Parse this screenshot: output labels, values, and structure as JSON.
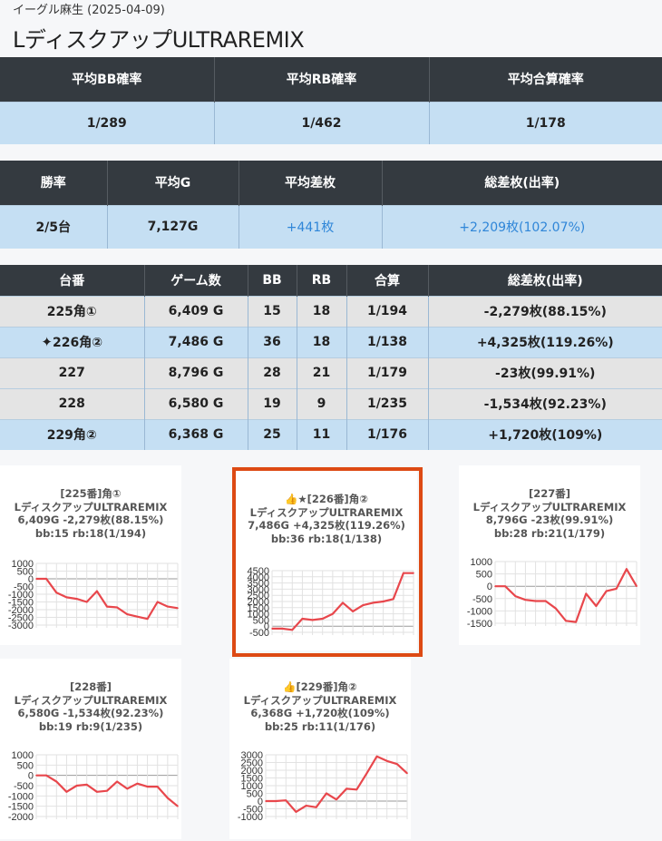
{
  "header": {
    "store_date": "イーグル麻生 (2025-04-09)",
    "machine_title": "LディスクアップULTRAREMIX"
  },
  "summary1": {
    "headers": [
      "平均BB確率",
      "平均RB確率",
      "平均合算確率"
    ],
    "values": [
      "1/289",
      "1/462",
      "1/178"
    ]
  },
  "summary2": {
    "headers": [
      "勝率",
      "平均G",
      "平均差枚",
      "総差枚(出率)"
    ],
    "values": [
      "2/5台",
      "7,127G",
      "+441枚",
      "+2,209枚(102.07%)"
    ]
  },
  "machines": {
    "headers": [
      "台番",
      "ゲーム数",
      "BB",
      "RB",
      "合算",
      "総差枚(出率)"
    ],
    "rows": [
      {
        "num": "225角①",
        "games": "6,409 G",
        "bb": "15",
        "rb": "18",
        "total": "1/194",
        "diff": "-2,279枚(88.15%)",
        "style": "gray",
        "icon": ""
      },
      {
        "num": "226角②",
        "games": "7,486 G",
        "bb": "36",
        "rb": "18",
        "total": "1/138",
        "diff": "+4,325枚(119.26%)",
        "style": "blue",
        "icon": "sparkles"
      },
      {
        "num": "227",
        "games": "8,796 G",
        "bb": "28",
        "rb": "21",
        "total": "1/179",
        "diff": "-23枚(99.91%)",
        "style": "gray",
        "icon": ""
      },
      {
        "num": "228",
        "games": "6,580 G",
        "bb": "19",
        "rb": "9",
        "total": "1/235",
        "diff": "-1,534枚(92.23%)",
        "style": "gray",
        "icon": ""
      },
      {
        "num": "229角②",
        "games": "6,368 G",
        "bb": "25",
        "rb": "11",
        "total": "1/176",
        "diff": "+1,720枚(109%)",
        "style": "blue",
        "icon": ""
      }
    ]
  },
  "chart_data": [
    {
      "type": "line",
      "title": [
        "[225番]角①",
        "LディスクアップULTRAREMIX",
        "6,409G -2,279枚(88.15%)",
        "bb:15 rb:18(1/194)"
      ],
      "ylim": [
        -3000,
        1000
      ],
      "yticks": [
        "1000",
        "500",
        "0",
        "-500",
        "-1000",
        "-1500",
        "-2000",
        "-2500",
        "-3000"
      ],
      "values": [
        0,
        0,
        -900,
        -1200,
        -1300,
        -1500,
        -800,
        -1800,
        -1850,
        -2300,
        -2450,
        -2600,
        -1500,
        -1800,
        -1900
      ],
      "color": "#e8474c"
    },
    {
      "type": "line",
      "title": [
        "👍★[226番]角②",
        "LディスクアップULTRAREMIX",
        "7,486G +4,325枚(119.26%)",
        "bb:36 rb:18(1/138)"
      ],
      "ylim": [
        -500,
        4500
      ],
      "yticks": [
        "4500",
        "4000",
        "3500",
        "3000",
        "2500",
        "2000",
        "1500",
        "1000",
        "500",
        "0",
        "-500"
      ],
      "values": [
        -200,
        -200,
        -300,
        600,
        500,
        600,
        1000,
        1900,
        1200,
        1700,
        1900,
        2000,
        2200,
        4300,
        4300
      ],
      "color": "#e8474c"
    },
    {
      "type": "line",
      "title": [
        "[227番]",
        "LディスクアップULTRAREMIX",
        "8,796G -23枚(99.91%)",
        "bb:28 rb:21(1/179)"
      ],
      "ylim": [
        -1500,
        1000
      ],
      "yticks": [
        "1000",
        "500",
        "0",
        "-500",
        "-1000",
        "-1500"
      ],
      "values": [
        0,
        0,
        -400,
        -550,
        -600,
        -600,
        -900,
        -1400,
        -1450,
        -300,
        -800,
        -200,
        -100,
        700,
        0
      ],
      "color": "#e8474c"
    },
    {
      "type": "line",
      "title": [
        "[228番]",
        "LディスクアップULTRAREMIX",
        "6,580G -1,534枚(92.23%)",
        "bb:19 rb:9(1/235)"
      ],
      "ylim": [
        -2000,
        1000
      ],
      "yticks": [
        "1000",
        "500",
        "0",
        "-500",
        "-1000",
        "-1500",
        "-2000"
      ],
      "values": [
        0,
        0,
        -300,
        -800,
        -500,
        -450,
        -800,
        -750,
        -300,
        -650,
        -400,
        -550,
        -550,
        -1100,
        -1500
      ],
      "color": "#e8474c"
    },
    {
      "type": "line",
      "title": [
        "👍[229番]角②",
        "LディスクアップULTRAREMIX",
        "6,368G +1,720枚(109%)",
        "bb:25 rb:11(1/176)"
      ],
      "ylim": [
        -1000,
        3000
      ],
      "yticks": [
        "3000",
        "2500",
        "2000",
        "1500",
        "1000",
        "500",
        "0",
        "-500",
        "-1000"
      ],
      "values": [
        0,
        0,
        50,
        -700,
        -300,
        -400,
        500,
        100,
        800,
        750,
        1800,
        2900,
        2600,
        2400,
        1800
      ],
      "color": "#e8474c"
    }
  ]
}
